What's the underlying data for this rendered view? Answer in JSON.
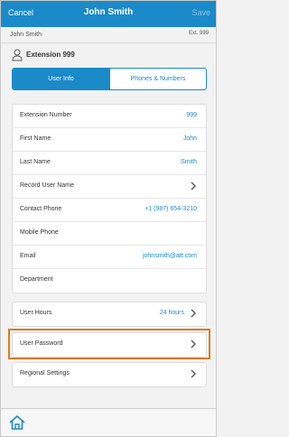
{
  "topbar": {
    "cancel": "Cancel",
    "title": "John Smith",
    "save": "Save"
  },
  "subbar": {
    "name": "John Smith",
    "ext": "Ext. 999"
  },
  "user": {
    "label": "Extension 999",
    "icon": "user-icon"
  },
  "tabs": [
    {
      "label": "User Info",
      "selected": true
    },
    {
      "label": "Phones & Numbers",
      "selected": false
    }
  ],
  "info_rows": [
    {
      "label": "Extension Number",
      "value": "999"
    },
    {
      "label": "First Name",
      "value": "John"
    },
    {
      "label": "Last Name",
      "value": "Smith"
    },
    {
      "label": "Record User Name",
      "value": ""
    },
    {
      "label": "Contact Phone",
      "value": "+1 (987) 654-3210"
    },
    {
      "label": "Mobile Phone",
      "value": ""
    },
    {
      "label": "Email",
      "value": "johnsmith@att.com"
    },
    {
      "label": "Department",
      "value": ""
    }
  ],
  "user_hours": {
    "label": "User Hours",
    "value": "24 hours"
  },
  "user_password": {
    "label": "User Password"
  },
  "regional_settings": {
    "label": "Regional Settings"
  },
  "colors": {
    "accent": "#1b8ac9",
    "highlight": "#e07a1f"
  },
  "bottombar": {
    "home_icon": "home-icon"
  }
}
